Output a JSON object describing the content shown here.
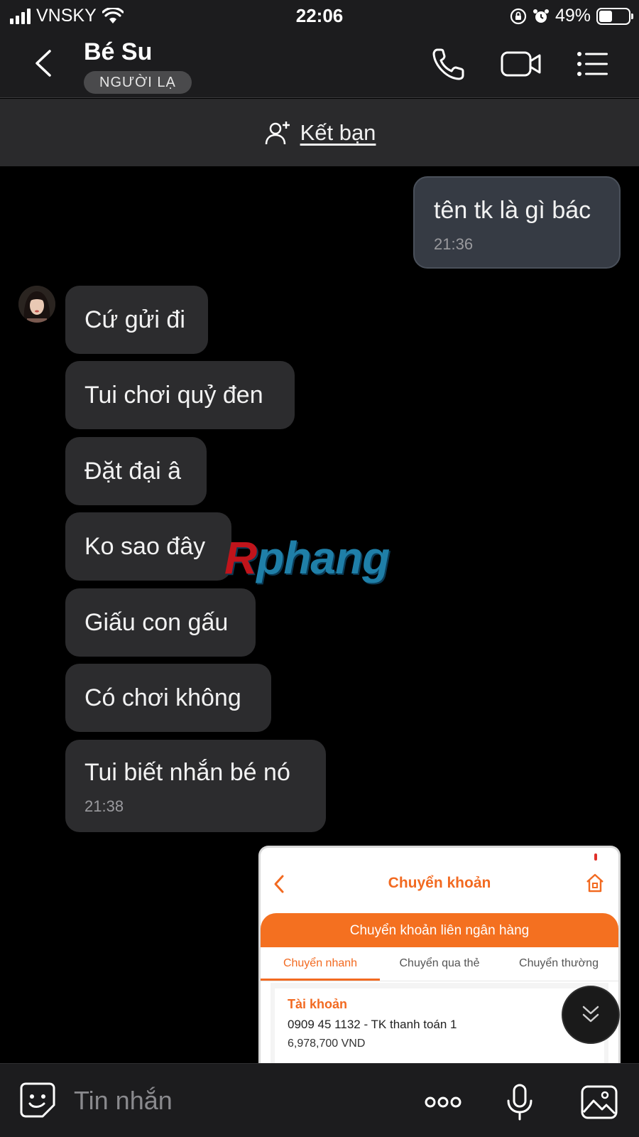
{
  "status_bar": {
    "carrier": "VNSKY",
    "time": "22:06",
    "battery": "49%"
  },
  "header": {
    "contact_name": "Bé Su",
    "badge": "NGƯỜI LẠ"
  },
  "add_friend": {
    "label": "Kết bạn"
  },
  "messages": [
    {
      "text": "tên tk là gì bác",
      "time": "21:36",
      "direction": "outgoing"
    },
    {
      "text": "Cứ gửi đi",
      "direction": "incoming"
    },
    {
      "text": "Tui chơi quỷ đen",
      "direction": "incoming"
    },
    {
      "text": "Đặt đại â",
      "direction": "incoming"
    },
    {
      "text": "Ko sao đây",
      "direction": "incoming"
    },
    {
      "text": "Giấu con gấu",
      "direction": "incoming"
    },
    {
      "text": "Có chơi không",
      "direction": "incoming"
    },
    {
      "text": "Tui biết nhắn bé nó",
      "time": "21:38",
      "direction": "incoming"
    }
  ],
  "watermark": {
    "first": "R",
    "rest": "phang"
  },
  "shared_screenshot": {
    "title": "Chuyển khoản",
    "banner": "Chuyển khoản liên ngân hàng",
    "tabs": [
      "Chuyển nhanh",
      "Chuyển qua thẻ",
      "Chuyển thường"
    ],
    "active_tab": 0,
    "account_label": "Tài khoản",
    "account_name": "0909 45 1132 - TK thanh toán 1",
    "balance": "6,978,700 VND",
    "accent_color": "#f26a21"
  },
  "composer": {
    "placeholder": "Tin nhắn"
  },
  "icons": {
    "back": "chevron-left-icon",
    "call": "phone-icon",
    "video": "video-camera-icon",
    "menu": "list-menu-icon",
    "add_friend": "add-user-icon",
    "emoji": "sticker-icon",
    "more": "more-dots-icon",
    "mic": "microphone-icon",
    "image": "image-icon",
    "scroll": "double-chevron-down-icon"
  }
}
